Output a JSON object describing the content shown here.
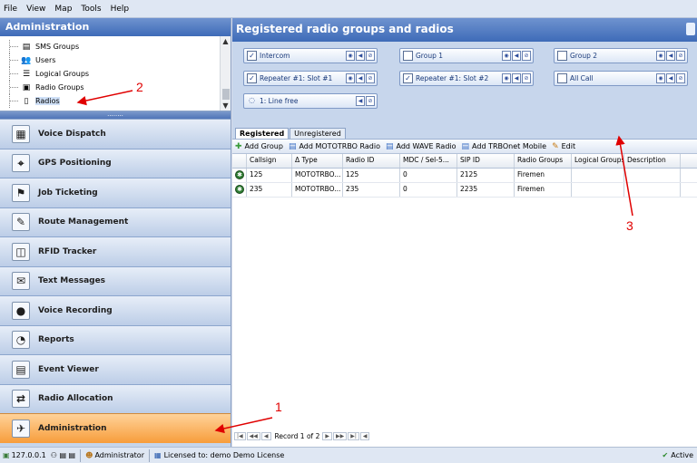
{
  "menu": [
    "File",
    "View",
    "Map",
    "Tools",
    "Help"
  ],
  "left": {
    "title": "Administration",
    "tree": [
      {
        "label": "SMS Groups",
        "icon": "▤"
      },
      {
        "label": "Users",
        "icon": "👥"
      },
      {
        "label": "Logical Groups",
        "icon": "☰"
      },
      {
        "label": "Radio Groups",
        "icon": "▣"
      },
      {
        "label": "Radios",
        "icon": "▯"
      }
    ],
    "grip": "........",
    "nav": [
      {
        "label": "Voice Dispatch",
        "icon": "▦"
      },
      {
        "label": "GPS Positioning",
        "icon": "⌖"
      },
      {
        "label": "Job Ticketing",
        "icon": "⚑"
      },
      {
        "label": "Route Management",
        "icon": "✎"
      },
      {
        "label": "RFID Tracker",
        "icon": "◫"
      },
      {
        "label": "Text Messages",
        "icon": "✉"
      },
      {
        "label": "Voice Recording",
        "icon": "●"
      },
      {
        "label": "Reports",
        "icon": "◔"
      },
      {
        "label": "Event Viewer",
        "icon": "▤"
      },
      {
        "label": "Radio Allocation",
        "icon": "⇄"
      },
      {
        "label": "Administration",
        "icon": "✈"
      }
    ]
  },
  "right": {
    "title": "Registered radio groups and radios",
    "groups": [
      {
        "label": "Intercom",
        "checked": true
      },
      {
        "label": "Group 1",
        "checked": false
      },
      {
        "label": "Group 2",
        "checked": false
      },
      {
        "label": "Repeater #1: Slot #1",
        "checked": true
      },
      {
        "label": "Repeater #1: Slot #2",
        "checked": true
      },
      {
        "label": "All Call",
        "checked": false
      },
      {
        "label": "1: Line free",
        "checked": false
      }
    ],
    "tabs": [
      "Registered",
      "Unregistered"
    ],
    "toolbar": [
      "Add Group",
      "Add MOTOTRBO Radio",
      "Add WAVE Radio",
      "Add TRBOnet Mobile",
      "Edit"
    ],
    "columns": [
      "",
      "Callsign",
      "Δ Type",
      "Radio ID",
      "MDC / Sel-5...",
      "SIP ID",
      "Radio Groups",
      "Logical Groups",
      "Description"
    ],
    "rows": [
      [
        "",
        "125",
        "MOTOTRBO...",
        "125",
        "0",
        "2125",
        "Firemen",
        "",
        ""
      ],
      [
        "",
        "235",
        "MOTOTRBO...",
        "235",
        "0",
        "2235",
        "Firemen",
        "",
        ""
      ]
    ],
    "pager": "Record 1 of 2"
  },
  "status": {
    "ip": "127.0.0.1",
    "user": "Administrator",
    "license": "Licensed to: demo Demo License",
    "active": "Active"
  },
  "annotations": [
    "1",
    "2",
    "3"
  ],
  "colors": {
    "accent": "#3e6bb8",
    "active_nav": "#f79d3b",
    "annotation": "#e00000"
  }
}
